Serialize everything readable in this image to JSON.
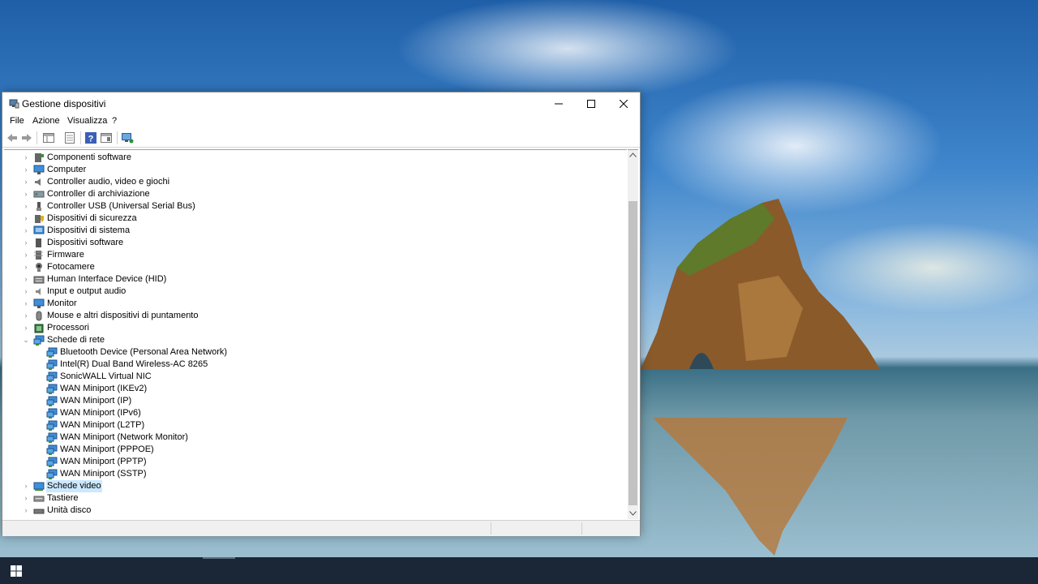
{
  "window": {
    "title": "Gestione dispositivi",
    "controls": {
      "minimize": "—",
      "maximize": "☐",
      "close": "✕"
    }
  },
  "menu": [
    "File",
    "Azione",
    "Visualizza",
    "?"
  ],
  "toolbar": [
    "back-icon",
    "forward-icon",
    "properties-pane-icon",
    "details-icon",
    "help-icon",
    "view-icon",
    "monitor-icon"
  ],
  "tree": [
    {
      "label": "Componenti software",
      "level": 0,
      "expander": "›",
      "icon": "software-component-icon"
    },
    {
      "label": "Computer",
      "level": 0,
      "expander": "›",
      "icon": "computer-icon"
    },
    {
      "label": "Controller audio, video e giochi",
      "level": 0,
      "expander": "›",
      "icon": "speaker-icon"
    },
    {
      "label": "Controller di archiviazione",
      "level": 0,
      "expander": "›",
      "icon": "storage-controller-icon"
    },
    {
      "label": "Controller USB (Universal Serial Bus)",
      "level": 0,
      "expander": "›",
      "icon": "usb-icon"
    },
    {
      "label": "Dispositivi di sicurezza",
      "level": 0,
      "expander": "›",
      "icon": "security-device-icon"
    },
    {
      "label": "Dispositivi di sistema",
      "level": 0,
      "expander": "›",
      "icon": "system-device-icon"
    },
    {
      "label": "Dispositivi software",
      "level": 0,
      "expander": "›",
      "icon": "software-device-icon"
    },
    {
      "label": "Firmware",
      "level": 0,
      "expander": "›",
      "icon": "firmware-icon"
    },
    {
      "label": "Fotocamere",
      "level": 0,
      "expander": "›",
      "icon": "camera-icon"
    },
    {
      "label": "Human Interface Device (HID)",
      "level": 0,
      "expander": "›",
      "icon": "hid-icon"
    },
    {
      "label": "Input e output audio",
      "level": 0,
      "expander": "›",
      "icon": "audio-io-icon"
    },
    {
      "label": "Monitor",
      "level": 0,
      "expander": "›",
      "icon": "monitor-icon"
    },
    {
      "label": "Mouse e altri dispositivi di puntamento",
      "level": 0,
      "expander": "›",
      "icon": "mouse-icon"
    },
    {
      "label": "Processori",
      "level": 0,
      "expander": "›",
      "icon": "processor-icon"
    },
    {
      "label": "Schede di rete",
      "level": 0,
      "expander": "⌄",
      "icon": "network-adapter-icon"
    },
    {
      "label": "Bluetooth Device (Personal Area Network)",
      "level": 1,
      "expander": "",
      "icon": "network-adapter-icon"
    },
    {
      "label": "Intel(R) Dual Band Wireless-AC 8265",
      "level": 1,
      "expander": "",
      "icon": "network-adapter-icon"
    },
    {
      "label": "SonicWALL Virtual NIC",
      "level": 1,
      "expander": "",
      "icon": "network-adapter-icon"
    },
    {
      "label": "WAN Miniport (IKEv2)",
      "level": 1,
      "expander": "",
      "icon": "network-adapter-icon"
    },
    {
      "label": "WAN Miniport (IP)",
      "level": 1,
      "expander": "",
      "icon": "network-adapter-icon"
    },
    {
      "label": "WAN Miniport (IPv6)",
      "level": 1,
      "expander": "",
      "icon": "network-adapter-icon"
    },
    {
      "label": "WAN Miniport (L2TP)",
      "level": 1,
      "expander": "",
      "icon": "network-adapter-icon"
    },
    {
      "label": "WAN Miniport (Network Monitor)",
      "level": 1,
      "expander": "",
      "icon": "network-adapter-icon"
    },
    {
      "label": "WAN Miniport (PPPOE)",
      "level": 1,
      "expander": "",
      "icon": "network-adapter-icon"
    },
    {
      "label": "WAN Miniport (PPTP)",
      "level": 1,
      "expander": "",
      "icon": "network-adapter-icon"
    },
    {
      "label": "WAN Miniport (SSTP)",
      "level": 1,
      "expander": "",
      "icon": "network-adapter-icon"
    },
    {
      "label": "Schede video",
      "level": 0,
      "expander": "›",
      "icon": "display-adapter-icon",
      "selected": true
    },
    {
      "label": "Tastiere",
      "level": 0,
      "expander": "›",
      "icon": "keyboard-icon"
    },
    {
      "label": "Unità disco",
      "level": 0,
      "expander": "›",
      "icon": "disk-drive-icon"
    }
  ],
  "taskbar": {
    "start_icon": "windows-start-icon"
  },
  "colors": {
    "accent": "#0078d7",
    "selection": "#cce8ff",
    "taskbar": "#1b2636"
  }
}
